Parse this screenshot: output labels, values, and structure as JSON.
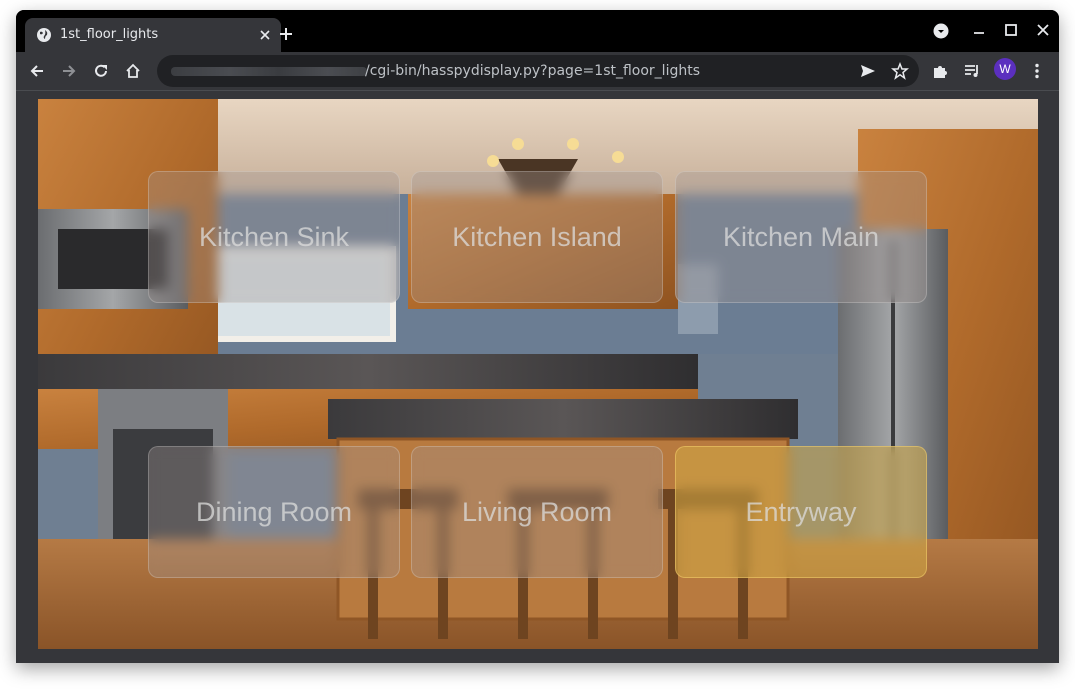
{
  "browser": {
    "tab_title": "1st_floor_lights",
    "url_path": "/cgi-bin/hasspydisplay.py?page=1st_floor_lights",
    "profile_initial": "W"
  },
  "page": {
    "tiles": [
      {
        "label": "Kitchen Sink",
        "on": false
      },
      {
        "label": "Kitchen Island",
        "on": false
      },
      {
        "label": "Kitchen Main",
        "on": false
      },
      {
        "label": "Dining Room",
        "on": false
      },
      {
        "label": "Living Room",
        "on": false
      },
      {
        "label": "Entryway",
        "on": true
      }
    ]
  },
  "colors": {
    "browser_frame": "#35363a",
    "tab_strip": "#000000",
    "tile_on": "#d2aa46",
    "profile_avatar": "#5b2fbf"
  }
}
